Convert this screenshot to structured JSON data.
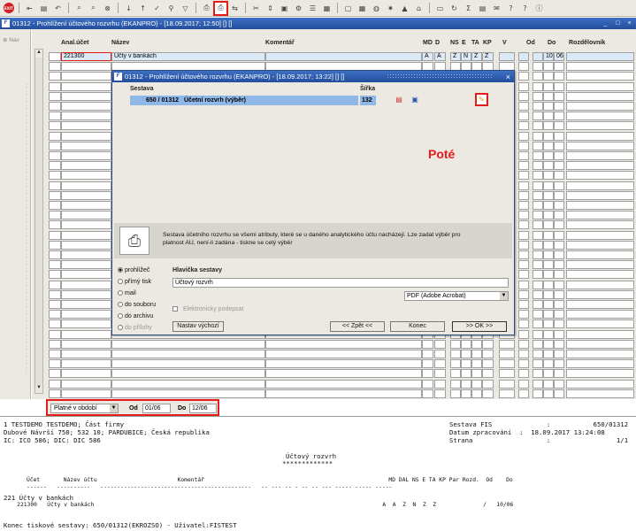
{
  "toolbar": {
    "exit_label": "EXIT"
  },
  "window": {
    "title": "01312 - Prohlížení účtového rozvrhu (EKANPRO) - [18.09.2017; 12:50] [] []"
  },
  "leftnav": {
    "label": "Nav"
  },
  "grid": {
    "headers": {
      "anal": "Anal.účet",
      "nazev": "Název",
      "komentar": "Komentář",
      "md": "MD",
      "d": "D",
      "ns": "NS",
      "e": "E",
      "ta": "TA",
      "kp": "KP",
      "v": "V",
      "od": "Od",
      "do": "Do",
      "rozdelovnik": "Rozdělovník"
    },
    "first_row": {
      "anal": "221300",
      "nazev": "Účty v bankách",
      "md": "A",
      "d": "A",
      "ns": "Z",
      "e": "N",
      "ta": "Z",
      "kp": "Z",
      "od": "10",
      "do": "06"
    }
  },
  "filter": {
    "period": "Platné v období",
    "od_label": "Od",
    "od_value": "01/06",
    "do_label": "Do",
    "do_value": "12/06"
  },
  "dialog": {
    "title": "01312 - Prohlížení účtového rozvrhu (EKANPRO) - [18.09.2017; 13:22] [] []",
    "sestava_label": "Sestava",
    "sirka_label": "Šířka",
    "sestava_number": "650 / 01312",
    "sestava_name": "Účetní rozvrh (výběr)",
    "sirka_value": "132",
    "annotation": "Poté",
    "info_text": "Sestava účetního rozvrhu se všemi atributy, které se u daného analytického účtu nacházejí. Lze zadat výběr pro platnost AU, není-li zadána - tiskne se celý výběr",
    "outputs": [
      "prohlížeč",
      "přímý tisk",
      "mail",
      "do souboru",
      "do archivu",
      "do přílohy"
    ],
    "hlavicka_label": "Hlavička sestavy",
    "hlavicka_value": "Účtový rozvrh",
    "format": "PDF (Adobe Acrobat)",
    "podpis_label": "Elektronicky podepsat",
    "btn_nastav": "Nastav výchozí",
    "btn_zpet": "<< Zpět <<",
    "btn_konec": "Konec",
    "btn_ok": ">> OK >>"
  },
  "report": {
    "l1": "1 TESTDEMO TESTDEMO; Část firmy",
    "l2": "Dubové Návrší 750; 532 10; PARDUBICE; Česká republika",
    "l3": "IC: ICO 586; DIC: DIC 586",
    "r1": "Sestava FIS              :           650/01312",
    "r2": "Datum zpracování  :  18.09.2017 13:24:08",
    "r3": "Strana                   :                 1/1",
    "t1": "Účtový rozvrh",
    "t2": "*************",
    "cols": "Účet       Název účtu                        Komentář                                                       MD DAL NS E TA KP Par Rozd.  Od    Do",
    "dashes": "------   ----------   ---------------------------------------------   -- --- -- - -- -- --- ----- ----- -----",
    "g1": "221 Účty v bankách",
    "g2": "    221300   Účty v bankách                                                                                      A  A  Z  N  Z  Z              /   10/06",
    "end": "Konec tiskové sestavy: 650/01312(EKROZSO) - Uživatel:FISTEST"
  }
}
